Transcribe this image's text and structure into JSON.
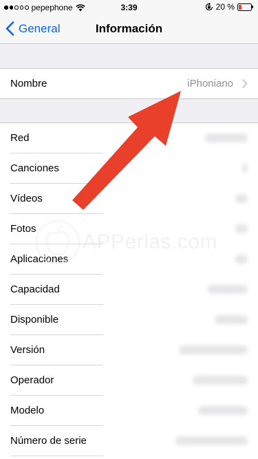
{
  "status_bar": {
    "carrier": "pepephone",
    "time": "3:39",
    "battery_percent": "20 %",
    "signal_bars_filled": 2,
    "battery_level": 0.2,
    "battery_color": "#ff3b30"
  },
  "nav": {
    "back_label": "General",
    "title": "Información",
    "accent": "#0a60fe"
  },
  "nombre": {
    "label": "Nombre",
    "value": "iPhoniano"
  },
  "rows": [
    {
      "label": "Red"
    },
    {
      "label": "Canciones"
    },
    {
      "label": "Vídeos"
    },
    {
      "label": "Fotos"
    },
    {
      "label": "Aplicaciones"
    },
    {
      "label": "Capacidad"
    },
    {
      "label": "Disponible"
    },
    {
      "label": "Versión"
    },
    {
      "label": "Operador"
    },
    {
      "label": "Modelo"
    },
    {
      "label": "Número de serie"
    }
  ],
  "watermark": {
    "text": "APPerlas.com"
  },
  "annotation_color": "#e8402a"
}
